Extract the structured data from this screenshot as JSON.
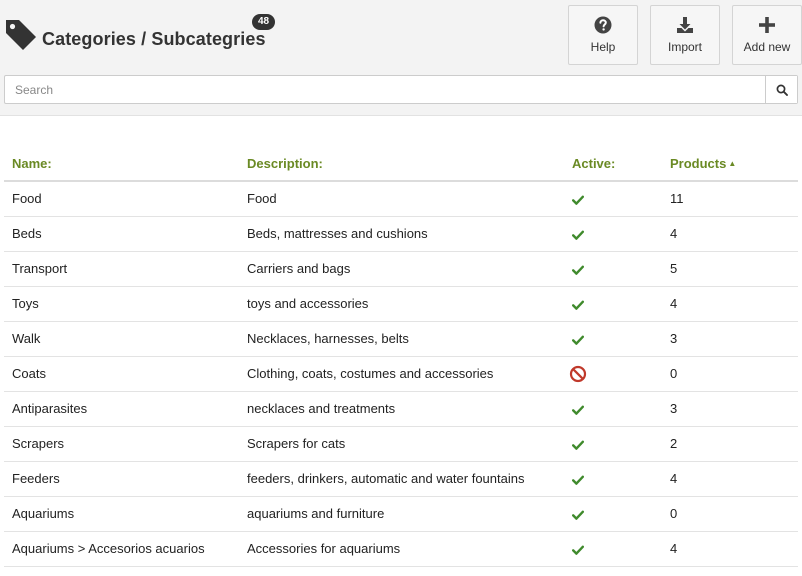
{
  "header": {
    "title": "Categories / Subcategries",
    "count_badge": "48"
  },
  "toolbar": {
    "help_label": "Help",
    "import_label": "Import",
    "add_new_label": "Add new"
  },
  "search": {
    "placeholder": "Search",
    "value": ""
  },
  "table": {
    "columns": {
      "name": "Name:",
      "description": "Description:",
      "active": "Active:",
      "products": "Products"
    },
    "rows": [
      {
        "name": "Food",
        "description": "Food",
        "active": true,
        "products": "11"
      },
      {
        "name": "Beds",
        "description": "Beds, mattresses and cushions",
        "active": true,
        "products": "4"
      },
      {
        "name": "Transport",
        "description": "Carriers and bags",
        "active": true,
        "products": "5"
      },
      {
        "name": "Toys",
        "description": "toys and accessories",
        "active": true,
        "products": "4"
      },
      {
        "name": "Walk",
        "description": "Necklaces, harnesses, belts",
        "active": true,
        "products": "3"
      },
      {
        "name": "Coats",
        "description": "Clothing, coats, costumes and accessories",
        "active": false,
        "products": "0"
      },
      {
        "name": "Antiparasites",
        "description": "necklaces and treatments",
        "active": true,
        "products": "3"
      },
      {
        "name": "Scrapers",
        "description": "Scrapers for cats",
        "active": true,
        "products": "2"
      },
      {
        "name": "Feeders",
        "description": "feeders, drinkers, automatic and water fountains",
        "active": true,
        "products": "4"
      },
      {
        "name": "Aquariums",
        "description": "aquariums and furniture",
        "active": true,
        "products": "0"
      },
      {
        "name": "Aquariums > Accesorios acuarios",
        "description": "Accessories for aquariums",
        "active": true,
        "products": "4"
      }
    ]
  },
  "colors": {
    "header_accent": "#6a8a24",
    "active_check": "#3f8a2c",
    "inactive_ban": "#c0392b"
  },
  "icons": {
    "title": "tag-icon",
    "help": "question-circle-icon",
    "import": "download-icon",
    "add_new": "plus-icon",
    "search": "magnifier-icon",
    "active": "check-icon",
    "inactive": "ban-icon",
    "sort": "sort-up-icon"
  }
}
